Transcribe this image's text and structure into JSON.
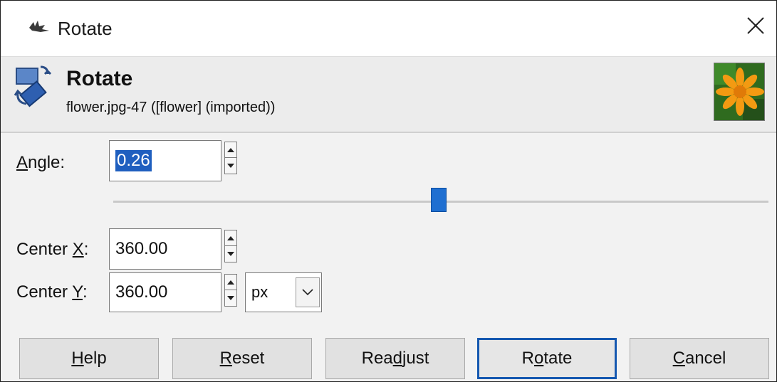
{
  "window": {
    "title": "Rotate"
  },
  "header": {
    "heading": "Rotate",
    "subtitle": "flower.jpg-47 ([flower] (imported))"
  },
  "angle": {
    "label_key": "A",
    "label_rest": "ngle:",
    "value": "0.26",
    "slider_fraction": 0.5
  },
  "center_x": {
    "label_pre": "Center ",
    "label_key": "X",
    "label_post": ":",
    "value": "360.00"
  },
  "center_y": {
    "label_pre": "Center ",
    "label_key": "Y",
    "label_post": ":",
    "value": "360.00"
  },
  "unit": {
    "selected": "px"
  },
  "buttons": {
    "help": {
      "key": "H",
      "rest": "elp"
    },
    "reset": {
      "key": "R",
      "rest": "eset"
    },
    "readjust": {
      "pre": "Rea",
      "key": "d",
      "rest": "just"
    },
    "rotate": {
      "pre": "R",
      "key": "o",
      "rest": "tate"
    },
    "cancel": {
      "key": "C",
      "rest": "ancel"
    }
  },
  "colors": {
    "accent": "#1f6fd1",
    "default_border": "#1558b0",
    "selection": "#1f5fbf"
  },
  "icons": [
    "gimp-icon",
    "close-icon",
    "rotate-tool-icon",
    "image-thumbnail",
    "spin-up-icon",
    "spin-down-icon",
    "chevron-down-icon"
  ]
}
